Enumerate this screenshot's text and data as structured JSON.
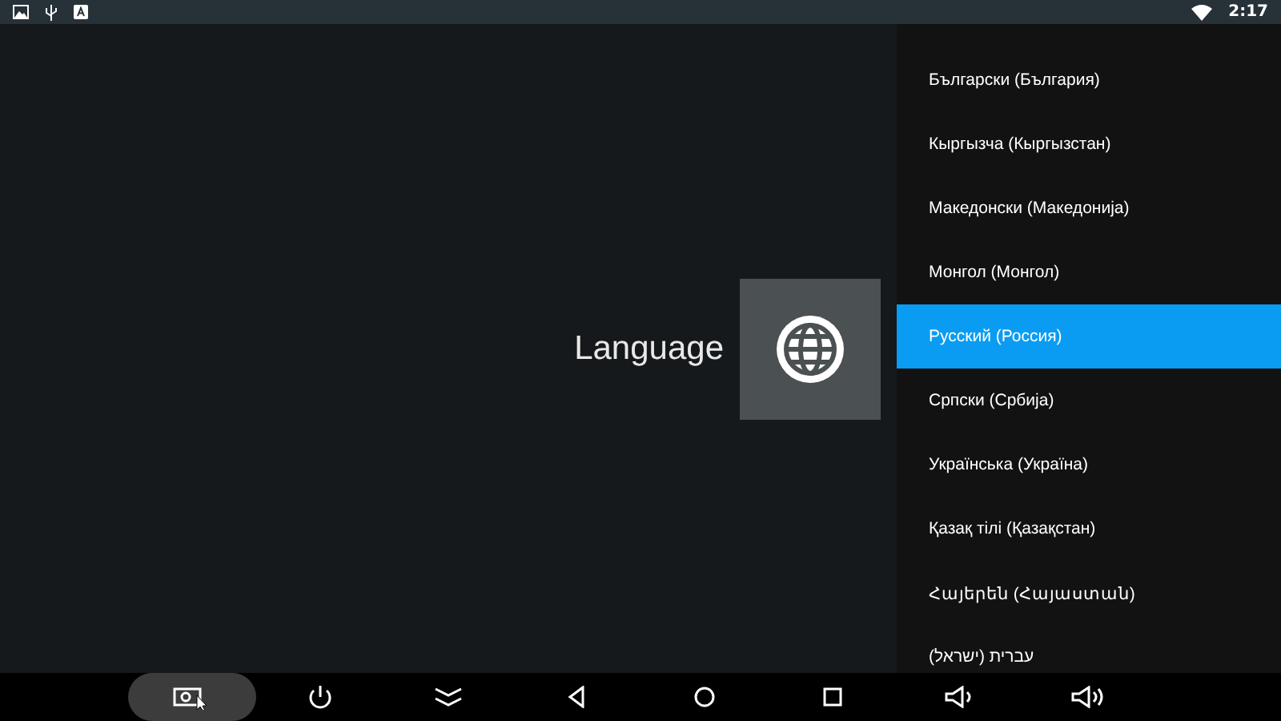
{
  "status_bar": {
    "time": "2:17"
  },
  "main": {
    "title": "Language"
  },
  "languages": [
    {
      "label": "Български (България)",
      "selected": false
    },
    {
      "label": "Кыргызча (Кыргызстан)",
      "selected": false
    },
    {
      "label": "Македонски (Македонија)",
      "selected": false
    },
    {
      "label": "Монгол (Монгол)",
      "selected": false
    },
    {
      "label": "Русский (Россия)",
      "selected": true
    },
    {
      "label": "Српски (Србија)",
      "selected": false
    },
    {
      "label": "Українська (Україна)",
      "selected": false
    },
    {
      "label": "Қазақ тілі (Қазақстан)",
      "selected": false
    },
    {
      "label": "Հայերեն (Հայաստան)",
      "selected": false
    },
    {
      "label": "עברית (ישראל)",
      "selected": false
    }
  ],
  "nav_bar": [
    {
      "kind": "screenshot",
      "selected": true
    },
    {
      "kind": "power",
      "selected": false
    },
    {
      "kind": "collapse",
      "selected": false
    },
    {
      "kind": "back",
      "selected": false
    },
    {
      "kind": "home",
      "selected": false
    },
    {
      "kind": "recents",
      "selected": false
    },
    {
      "kind": "volume-down",
      "selected": false
    },
    {
      "kind": "volume-up",
      "selected": false
    }
  ]
}
